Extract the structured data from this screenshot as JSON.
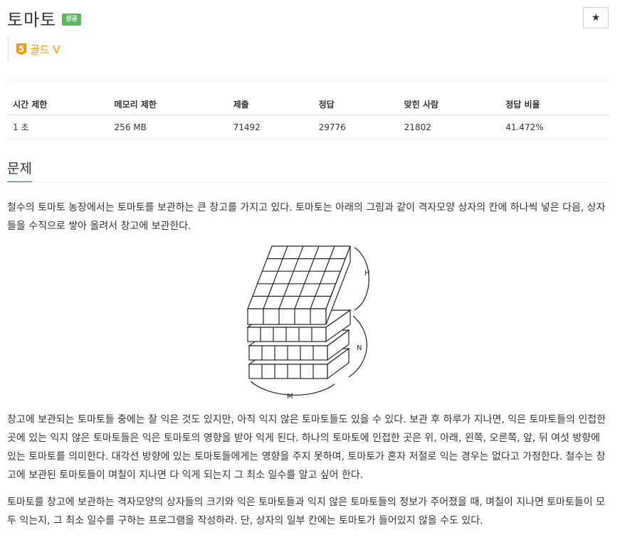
{
  "problem": {
    "title": "토마토",
    "status_badge": "성공",
    "star_icon": "★",
    "tier": {
      "level": "5",
      "label": "골드 V",
      "color": "#ec9a00"
    }
  },
  "stats": {
    "headers": [
      "시간 제한",
      "메모리 제한",
      "제출",
      "정답",
      "맞힌 사람",
      "정답 비율"
    ],
    "values": [
      "1 초",
      "256 MB",
      "71492",
      "29776",
      "21802",
      "41.472%"
    ]
  },
  "section": {
    "title": "문제"
  },
  "description": {
    "paragraph1": "철수의 토마토 농장에서는 토마토를 보관하는 큰 창고를 가지고 있다. 토마토는 아래의 그림과 같이 격자모양 상자의 칸에 하나씩 넣은 다음, 상자들을 수직으로 쌓아 올려서 창고에 보관한다.",
    "paragraph2": "창고에 보관되는 토마토들 중에는 잘 익은 것도 있지만, 아직 익지 않은 토마토들도 있을 수 있다. 보관 후 하루가 지나면, 익은 토마토들의 인접한 곳에 있는 익지 않은 토마토들은 익은 토마토의 영향을 받아 익게 된다. 하나의 토마토에 인접한 곳은 위, 아래, 왼쪽, 오른쪽, 앞, 뒤 여섯 방향에 있는 토마토를 의미한다. 대각선 방향에 있는 토마토들에게는 영향을 주지 못하며, 토마토가 혼자 저절로 익는 경우는 없다고 가정한다. 철수는 창고에 보관된 토마토들이 며칠이 지나면 다 익게 되는지 그 최소 일수를 알고 싶어 한다.",
    "paragraph3": "토마토를 창고에 보관하는 격자모양의 상자들의 크기와 익은 토마토들과 익지 않은 토마토들의 정보가 주어졌을 때, 며칠이 지나면 토마토들이 모두 익는지, 그 최소 일수를 구하는 프로그램을 작성하라. 단, 상자의 일부 칸에는 토마토가 들어있지 않을 수도 있다."
  },
  "figure": {
    "labels": {
      "h": "H",
      "n": "N",
      "m": "M"
    }
  }
}
